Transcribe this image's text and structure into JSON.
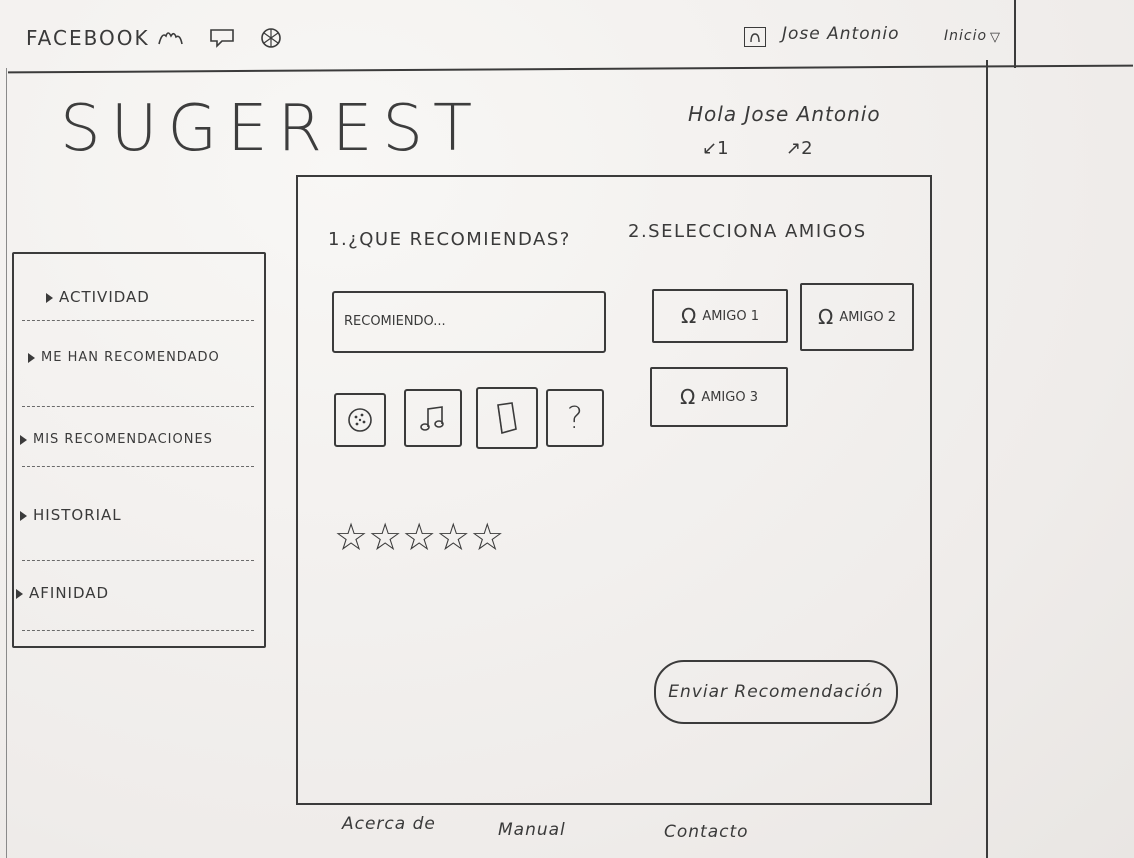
{
  "topbar": {
    "brand": "FACEBOOK",
    "icons": [
      "friends-icon",
      "messages-icon",
      "globe-icon"
    ],
    "user_icon": "user-icon",
    "user_name": "Jose Antonio",
    "home_label": "Inicio",
    "home_caret": "▽"
  },
  "header": {
    "logo": "SUGEREST",
    "greeting": "Hola Jose Antonio",
    "step1_marker": "↙1",
    "step2_marker": "↗2"
  },
  "sidebar": {
    "items": [
      {
        "label": "ACTIVIDAD"
      },
      {
        "label": "ME HAN RECOMENDADO"
      },
      {
        "label": "MIS RECOMENDACIONES"
      },
      {
        "label": "HISTORIAL"
      },
      {
        "label": "AFINIDAD"
      }
    ]
  },
  "recommend": {
    "title": "1.¿QUE RECOMIENDAS?",
    "input_placeholder": "RECOMIENDO...",
    "type_buttons": [
      {
        "icon": "food-icon",
        "glyph": "🍪"
      },
      {
        "icon": "music-icon",
        "glyph": "♫"
      },
      {
        "icon": "book-icon",
        "glyph": "▱"
      },
      {
        "icon": "other-icon",
        "glyph": "?"
      }
    ],
    "rating": {
      "stars_shown": 5,
      "value": 0,
      "glyph": "☆☆☆☆☆"
    }
  },
  "friends": {
    "title": "2.SELECCIONA AMIGOS",
    "icon": "Ω",
    "items": [
      {
        "label": "AMIGO 1"
      },
      {
        "label": "AMIGO 2"
      },
      {
        "label": "AMIGO 3"
      }
    ]
  },
  "send_button": "Enviar Recomendación",
  "footer": {
    "links": [
      "Acerca de",
      "Manual",
      "Contacto"
    ]
  }
}
